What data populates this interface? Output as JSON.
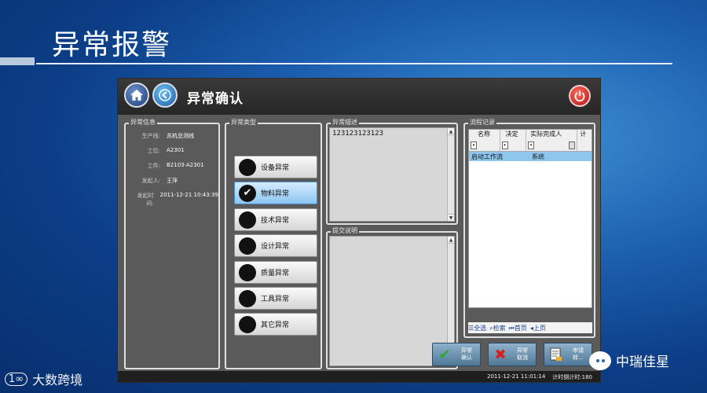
{
  "slide": {
    "title": "异常报警"
  },
  "window": {
    "title": "异常确认",
    "status_time": "2011-12-21 11:01:14",
    "status_timer": "计时倒计时:180"
  },
  "info": {
    "label": "异常信息",
    "rows": [
      {
        "key": "生产线:",
        "value": "苏杭总测线"
      },
      {
        "key": "工位:",
        "value": "A2301"
      },
      {
        "key": "工件:",
        "value": "B2103-A2301"
      },
      {
        "key": "发起人:",
        "value": "王萍"
      },
      {
        "key": "发起时间:",
        "value": "2011-12-21 10:43:39"
      }
    ]
  },
  "types": {
    "label": "异常类型",
    "items": [
      {
        "label": "设备异常",
        "selected": false
      },
      {
        "label": "物料异常",
        "selected": true
      },
      {
        "label": "技术异常",
        "selected": false
      },
      {
        "label": "设计异常",
        "selected": false
      },
      {
        "label": "质量异常",
        "selected": false
      },
      {
        "label": "工具异常",
        "selected": false
      },
      {
        "label": "其它异常",
        "selected": false
      }
    ]
  },
  "description": {
    "label": "异常描述",
    "value": "123123123123"
  },
  "remark": {
    "label": "提交说明",
    "value": ""
  },
  "flow": {
    "label": "流程记录",
    "columns": [
      "名称",
      "决定",
      "实际完成人",
      "计"
    ],
    "rows": [
      {
        "name": "启动工作流",
        "decision": "",
        "person": "系统"
      }
    ],
    "pager": [
      "全选",
      "检索",
      "首页",
      "上页"
    ]
  },
  "actions": [
    {
      "label": "异常\n确认",
      "icon": "check-icon",
      "color": "#2fa82f"
    },
    {
      "label": "异常\n取消",
      "icon": "cross-icon",
      "color": "#d62020"
    },
    {
      "label": "申请\n转…",
      "icon": "document-icon",
      "color": "#f0f0f0"
    }
  ],
  "watermarks": {
    "left": "大数跨境",
    "left_logo": "1∞",
    "right": "中瑞佳星"
  }
}
